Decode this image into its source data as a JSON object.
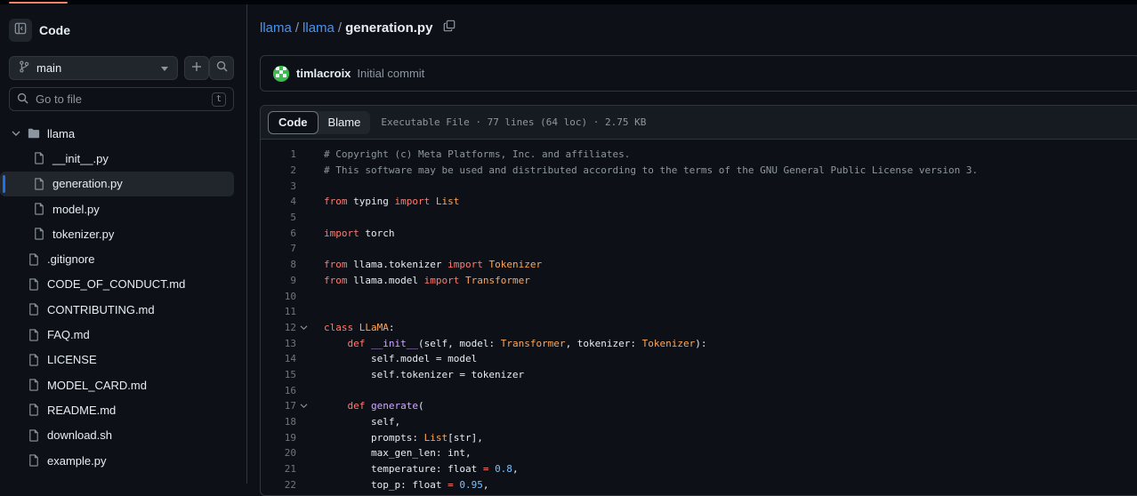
{
  "sidebar": {
    "title": "Code",
    "branch": "main",
    "goto_placeholder": "Go to file",
    "goto_shortcut": "t",
    "tree": [
      {
        "label": "llama",
        "type": "folder",
        "expanded": true
      },
      {
        "label": "__init__.py",
        "type": "file",
        "child": true
      },
      {
        "label": "generation.py",
        "type": "file",
        "child": true,
        "selected": true
      },
      {
        "label": "model.py",
        "type": "file",
        "child": true
      },
      {
        "label": "tokenizer.py",
        "type": "file",
        "child": true
      },
      {
        "label": ".gitignore",
        "type": "file"
      },
      {
        "label": "CODE_OF_CONDUCT.md",
        "type": "file"
      },
      {
        "label": "CONTRIBUTING.md",
        "type": "file"
      },
      {
        "label": "FAQ.md",
        "type": "file"
      },
      {
        "label": "LICENSE",
        "type": "file"
      },
      {
        "label": "MODEL_CARD.md",
        "type": "file"
      },
      {
        "label": "README.md",
        "type": "file"
      },
      {
        "label": "download.sh",
        "type": "file"
      },
      {
        "label": "example.py",
        "type": "file"
      }
    ]
  },
  "breadcrumb": {
    "repo": "llama",
    "folder": "llama",
    "file": "generation.py",
    "sep": "/"
  },
  "commit": {
    "author": "timlacroix",
    "message": "Initial commit"
  },
  "file": {
    "tabs": [
      "Code",
      "Blame"
    ],
    "active_tab": "Code",
    "meta": "Executable File · 77 lines (64 loc) · 2.75 KB"
  },
  "code_lines": [
    {
      "n": "1",
      "fold": false,
      "tokens": [
        [
          "cm",
          "# Copyright (c) Meta Platforms, Inc. and affiliates."
        ]
      ]
    },
    {
      "n": "2",
      "fold": false,
      "tokens": [
        [
          "cm",
          "# This software may be used and distributed according to the terms of the GNU General Public License version 3."
        ]
      ]
    },
    {
      "n": "3",
      "fold": false,
      "tokens": []
    },
    {
      "n": "4",
      "fold": false,
      "tokens": [
        [
          "kw",
          "from"
        ],
        [
          "",
          " typing "
        ],
        [
          "kw",
          "import"
        ],
        [
          "",
          " "
        ],
        [
          "ty",
          "List"
        ]
      ]
    },
    {
      "n": "5",
      "fold": false,
      "tokens": []
    },
    {
      "n": "6",
      "fold": false,
      "tokens": [
        [
          "kw",
          "import"
        ],
        [
          "",
          " torch"
        ]
      ]
    },
    {
      "n": "7",
      "fold": false,
      "tokens": []
    },
    {
      "n": "8",
      "fold": false,
      "tokens": [
        [
          "kw",
          "from"
        ],
        [
          "",
          " llama.tokenizer "
        ],
        [
          "kw",
          "import"
        ],
        [
          "",
          " "
        ],
        [
          "ty",
          "Tokenizer"
        ]
      ]
    },
    {
      "n": "9",
      "fold": false,
      "tokens": [
        [
          "kw",
          "from"
        ],
        [
          "",
          " llama.model "
        ],
        [
          "kw",
          "import"
        ],
        [
          "",
          " "
        ],
        [
          "ty",
          "Transformer"
        ]
      ]
    },
    {
      "n": "10",
      "fold": false,
      "tokens": []
    },
    {
      "n": "11",
      "fold": false,
      "tokens": []
    },
    {
      "n": "12",
      "fold": true,
      "tokens": [
        [
          "kw",
          "class"
        ],
        [
          "",
          " "
        ],
        [
          "ty",
          "LLaMA"
        ],
        [
          "",
          ":"
        ]
      ]
    },
    {
      "n": "13",
      "fold": false,
      "tokens": [
        [
          "",
          "    "
        ],
        [
          "kw",
          "def"
        ],
        [
          "",
          " "
        ],
        [
          "fn",
          "__init__"
        ],
        [
          "",
          "(self, model: "
        ],
        [
          "ty",
          "Transformer"
        ],
        [
          "",
          ", tokenizer: "
        ],
        [
          "ty",
          "Tokenizer"
        ],
        [
          "",
          "):"
        ]
      ]
    },
    {
      "n": "14",
      "fold": false,
      "tokens": [
        [
          "",
          "        self.model = model"
        ]
      ]
    },
    {
      "n": "15",
      "fold": false,
      "tokens": [
        [
          "",
          "        self.tokenizer = tokenizer"
        ]
      ]
    },
    {
      "n": "16",
      "fold": false,
      "tokens": []
    },
    {
      "n": "17",
      "fold": true,
      "tokens": [
        [
          "",
          "    "
        ],
        [
          "kw",
          "def"
        ],
        [
          "",
          " "
        ],
        [
          "fn",
          "generate"
        ],
        [
          "",
          "("
        ]
      ]
    },
    {
      "n": "18",
      "fold": false,
      "tokens": [
        [
          "",
          "        self,"
        ]
      ]
    },
    {
      "n": "19",
      "fold": false,
      "tokens": [
        [
          "",
          "        prompts: "
        ],
        [
          "ty",
          "List"
        ],
        [
          "",
          "[str],"
        ]
      ]
    },
    {
      "n": "20",
      "fold": false,
      "tokens": [
        [
          "",
          "        max_gen_len: int,"
        ]
      ]
    },
    {
      "n": "21",
      "fold": false,
      "tokens": [
        [
          "",
          "        temperature: float "
        ],
        [
          "kw",
          "="
        ],
        [
          "",
          " "
        ],
        [
          "nu",
          "0.8"
        ],
        [
          "",
          ","
        ]
      ]
    },
    {
      "n": "22",
      "fold": false,
      "tokens": [
        [
          "",
          "        top_p: float "
        ],
        [
          "kw",
          "="
        ],
        [
          "",
          " "
        ],
        [
          "nu",
          "0.95"
        ],
        [
          "",
          ","
        ]
      ]
    }
  ]
}
